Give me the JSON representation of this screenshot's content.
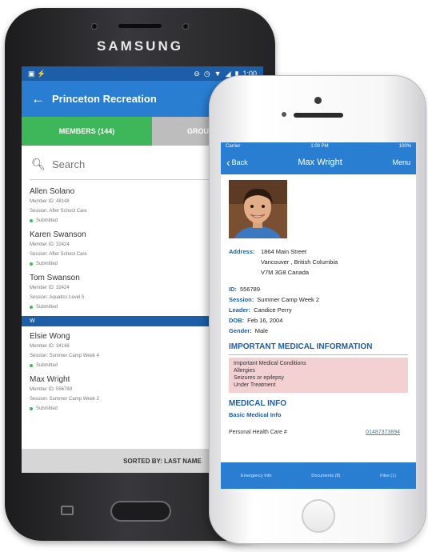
{
  "samsung": {
    "brand": "SAMSUNG",
    "status_time": "1:00",
    "toolbar": {
      "title": "Princeton Recreation"
    },
    "tabs": [
      {
        "label": "MEMBERS (144)"
      },
      {
        "label": "GROU"
      }
    ],
    "search": {
      "placeholder": "Search"
    },
    "members": [
      {
        "name": "Allen Solano",
        "member_id": "Member ID: 48148",
        "session": "Session: After School Care",
        "status": "Submitted"
      },
      {
        "name": "Karen Swanson",
        "member_id": "Member ID: 32424",
        "session": "Session: After School Care",
        "status": "Submitted"
      },
      {
        "name": "Tom Swanson",
        "member_id": "Member ID: 32424",
        "session": "Session: Aquatics Level 5",
        "status": "Submitted"
      }
    ],
    "divider": "W",
    "members_w": [
      {
        "name": "Elsie Wong",
        "member_id": "Member ID: 34148",
        "session": "Session: Summer Camp Week 4",
        "status": "Submitted"
      },
      {
        "name": "Max Wright",
        "member_id": "Member ID: 556789",
        "session": "Session: Summer Camp Week 2",
        "status": "Submitted"
      }
    ],
    "footer": "SORTED BY: LAST NAME",
    "status_color": "#3eb65a",
    "accent": "#2a7ed2"
  },
  "iphone": {
    "status_left": "Carrier",
    "status_time": "1:00 PM",
    "status_right": "100%",
    "nav": {
      "back": "Back",
      "title": "Max Wright",
      "menu": "Menu"
    },
    "address": {
      "label": "Address:",
      "lines": [
        "1864 Main Street",
        "Vancouver , British Columbia",
        "V7M 3G8 Canada"
      ]
    },
    "fields": [
      {
        "label": "ID:",
        "value": "556789"
      },
      {
        "label": "Session:",
        "value": "Summer Camp Week 2"
      },
      {
        "label": "Leader:",
        "value": "Candice Perry"
      },
      {
        "label": "DOB:",
        "value": "Feb 16, 2004"
      },
      {
        "label": "Gender:",
        "value": "Male"
      }
    ],
    "medical_title": "IMPORTANT MEDICAL INFORMATION",
    "medical_items": [
      "Important Medical Conditions",
      "Allergies",
      "Seizures or epilepsy",
      "Under Treatment"
    ],
    "medical_info_title": "MEDICAL INFO",
    "basic_medical": "Basic Medical Info",
    "health_card": {
      "label": "Personal Health Care #",
      "value": "01487373894"
    },
    "tabbar": [
      "Emergency Info",
      "Documents (8)",
      "Files (1)"
    ],
    "medical_box_color": "#f3d1d3"
  }
}
